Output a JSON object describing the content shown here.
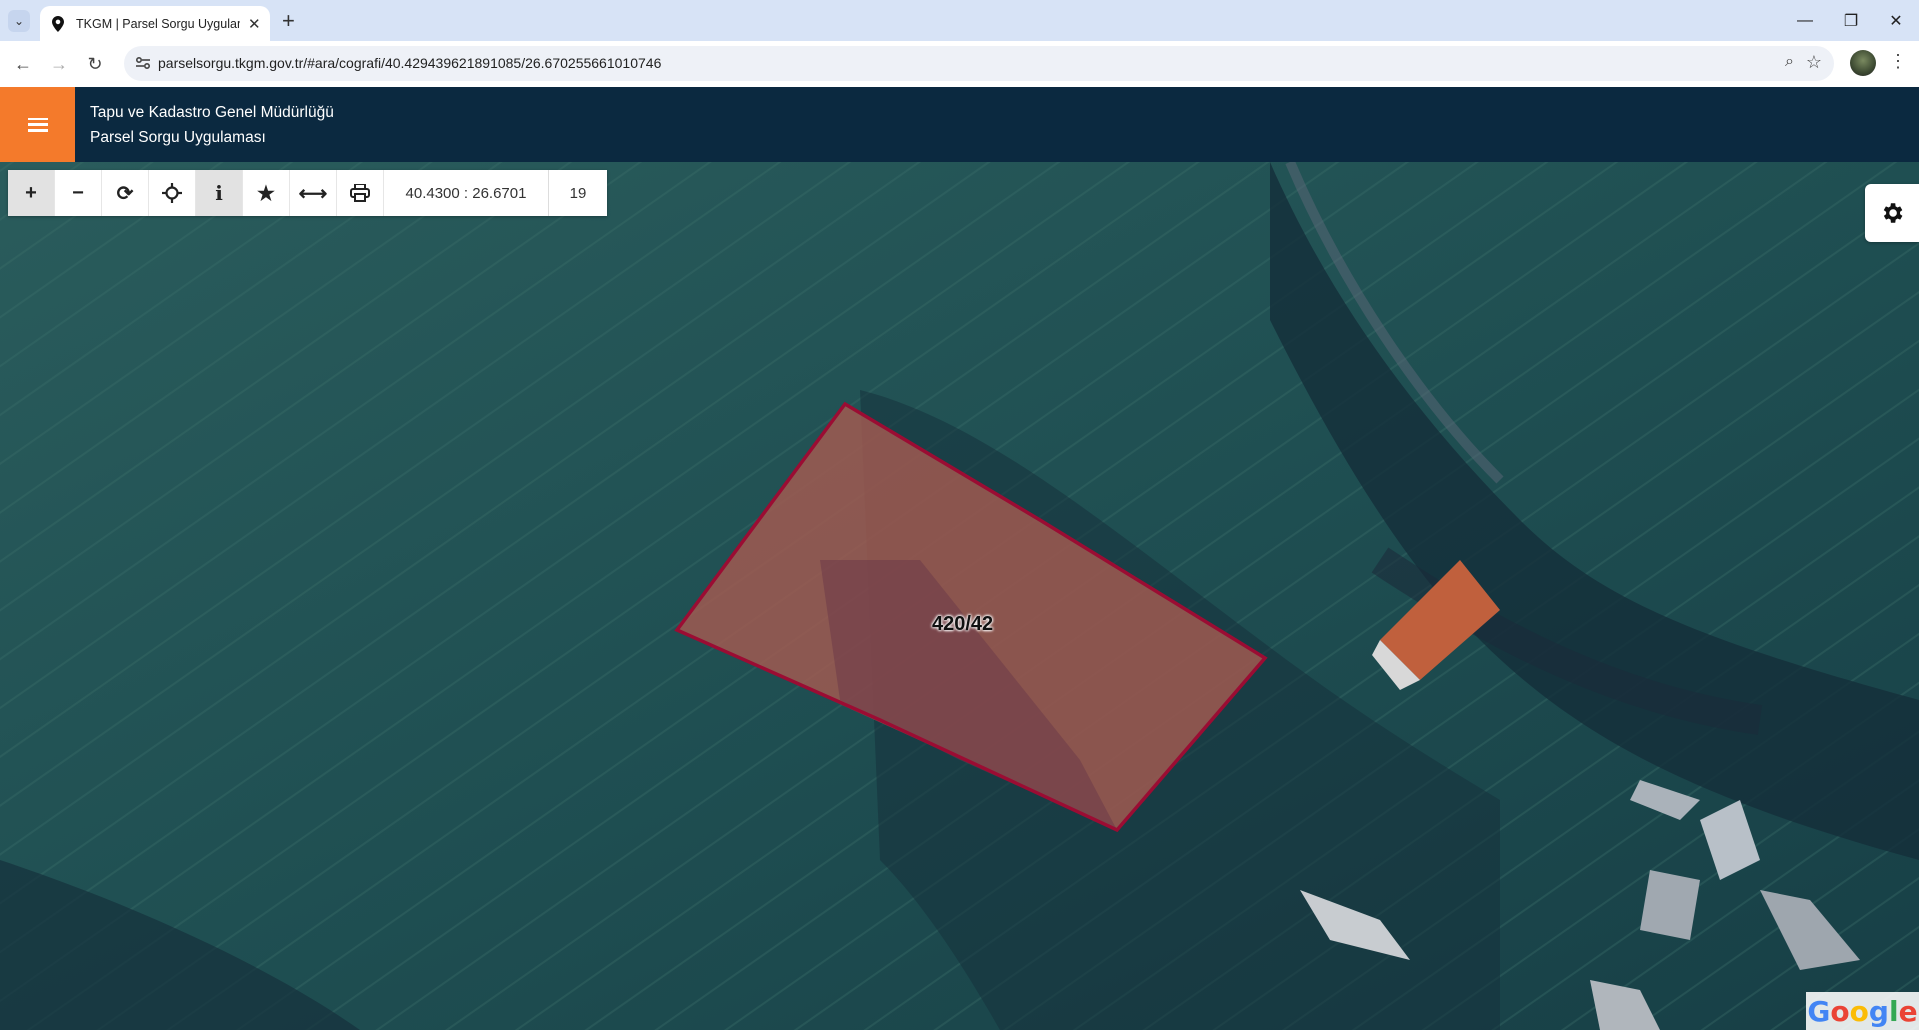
{
  "browser": {
    "tab_title": "TKGM | Parsel Sorgu Uygulaması",
    "url": "parselsorgu.tkgm.gov.tr/#ara/cografi/40.429439621891085/26.670255661010746"
  },
  "header": {
    "org_name": "Tapu ve Kadastro Genel Müdürlüğü",
    "app_name": "Parsel Sorgu Uygulaması"
  },
  "toolbar": {
    "coordinates": "40.4300 : 26.6701",
    "zoom_level": "19",
    "tools": [
      "zoom-in-icon",
      "zoom-out-icon",
      "refresh-icon",
      "locate-icon",
      "info-icon",
      "favorite-icon",
      "measure-icon",
      "print-icon"
    ]
  },
  "map": {
    "parcel_label": "420/42",
    "attribution": [
      "G",
      "o",
      "o",
      "g",
      "l",
      "e"
    ],
    "parcel_outline_color": "#9b0c33",
    "accent_color": "#f47a2b",
    "header_color": "#0b2940"
  }
}
